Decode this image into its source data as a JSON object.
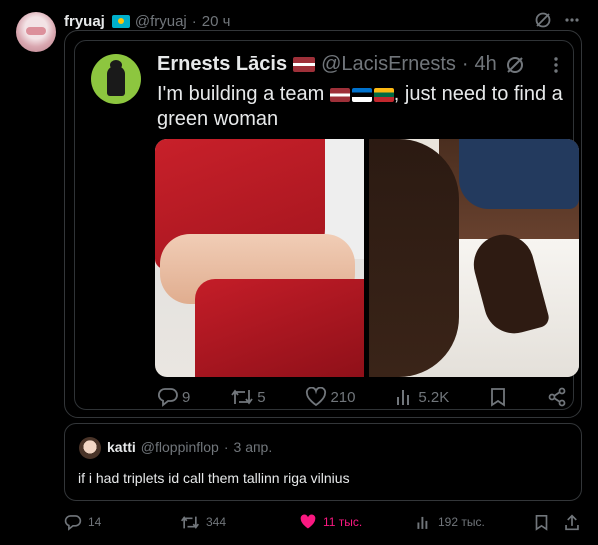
{
  "post": {
    "author_name": "fryuaj",
    "author_handle": "@fryuaj",
    "separator": "·",
    "time": "20 ч"
  },
  "quote": {
    "author_name": "Ernests Lācis",
    "author_handle": "@LacisErnests",
    "separator": "·",
    "time": "4h",
    "text_before": "I'm building a team ",
    "text_after": ", just need to find a green woman",
    "actions": {
      "replies": "9",
      "reposts": "5",
      "likes": "210",
      "views": "5.2K"
    }
  },
  "reply": {
    "author_name": "katti",
    "author_handle": "@floppinflop",
    "separator": "·",
    "time": "3 апр.",
    "text": "if i had triplets id call them tallinn riga vilnius"
  },
  "actions": {
    "replies": "14",
    "reposts": "344",
    "likes": "11 тыс.",
    "views": "192 тыс."
  },
  "colors": {
    "background": "#000000",
    "text": "#e7e9ea",
    "muted": "#71767b",
    "like_active": "#f91880",
    "border": "#333639"
  },
  "icons": [
    "grok-icon",
    "more-icon",
    "reply-icon",
    "repost-icon",
    "like-icon",
    "views-icon",
    "bookmark-icon",
    "share-icon"
  ]
}
